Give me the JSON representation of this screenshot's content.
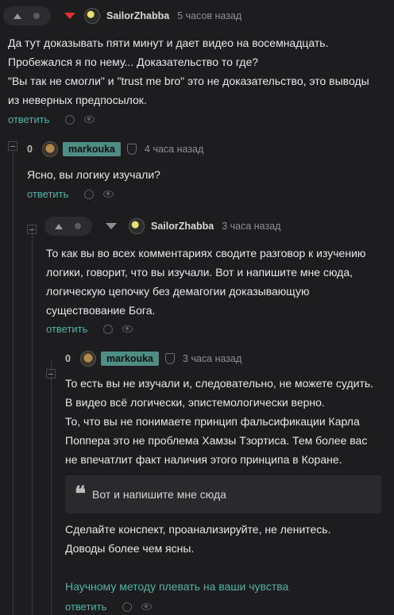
{
  "comments": [
    {
      "username": "SailorZhabba",
      "time": "5 часов назад",
      "text": "Да тут доказывать пяти минут и дает видео на восемнадцать.\nПробежался я по нему... Доказательство то где?\n\"Вы так не смогли\" и \"trust me bro\" это не доказательство, это выводы\nиз неверных предпосылок.",
      "reply_label": "ответить"
    },
    {
      "score": "0",
      "username": "markouka",
      "time": "4 часа назад",
      "text": "Ясно, вы логику изучали?",
      "reply_label": "ответить"
    },
    {
      "username": "SailorZhabba",
      "time": "3 часа назад",
      "text": "То как вы во всех комментариях сводите разговор к изучению\nлогики, говорит, что вы изучали. Вот и напишите мне сюда,\nлогическую цепочку без демагогии доказывающую\nсуществование Бога.",
      "reply_label": "ответить"
    },
    {
      "score": "0",
      "username": "markouka",
      "time": "3 часа назад",
      "text": "То есть вы не изучали и, следовательно, не можете судить.\nВ видео всё логически, эпистемологически верно.\nТо, что вы не понимаете принцип фальсификации Карла\nПоппера это не проблема Хамзы Тзортиса. Тем более вас\nне впечатлит факт наличия этого принципа в Коране.",
      "quote": "Вот и напишите мне сюда",
      "text2": "Сделайте конспект, проанализируйте, не ленитесь.\nДоводы более чем ясны.",
      "link": "Научному методу плевать на ваши чувства",
      "reply_label": "ответить"
    }
  ],
  "colors": {
    "background": "#1d1d1f",
    "accent": "#4fb3a6",
    "badge": "#4e8d83",
    "downvote_active": "#e0312c"
  },
  "icons": [
    "upvote-icon",
    "downvote-icon",
    "ban-icon",
    "eye-icon",
    "shield-icon",
    "collapse-icon",
    "quote-icon",
    "avatar"
  ]
}
